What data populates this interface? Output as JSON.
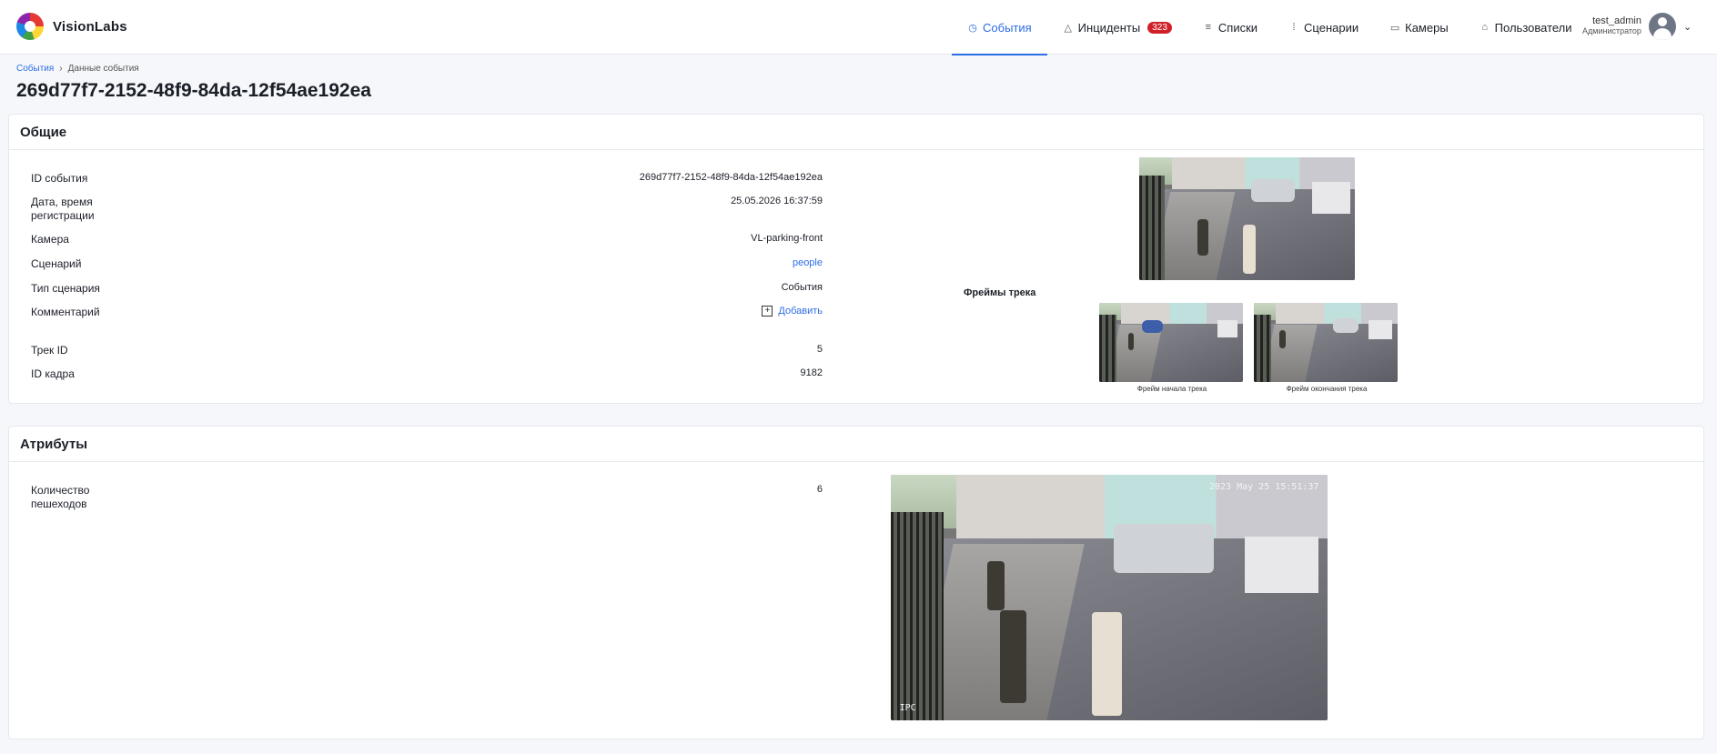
{
  "app": {
    "name": "VisionLabs"
  },
  "nav": {
    "items": [
      {
        "label": "События",
        "icon": "clock-icon"
      },
      {
        "label": "Инциденты",
        "icon": "warning-icon",
        "badge": "323"
      },
      {
        "label": "Списки",
        "icon": "list-icon"
      },
      {
        "label": "Сценарии",
        "icon": "scenario-icon"
      },
      {
        "label": "Камеры",
        "icon": "camera-icon"
      },
      {
        "label": "Пользователи",
        "icon": "users-icon"
      }
    ],
    "active": "События"
  },
  "user": {
    "name": "test_admin",
    "role": "Администратор"
  },
  "breadcrumb": {
    "root": "События",
    "current": "Данные события"
  },
  "page": {
    "title": "269d77f7-2152-48f9-84da-12f54ae192ea"
  },
  "general": {
    "title": "Общие",
    "fields": {
      "event_id": {
        "label": "ID события",
        "value": "269d77f7-2152-48f9-84da-12f54ae192ea"
      },
      "datetime": {
        "label": "Дата, время регистрации",
        "value": "25.05.2026 16:37:59"
      },
      "camera": {
        "label": "Камера",
        "value": "VL-parking-front"
      },
      "scenario": {
        "label": "Сценарий",
        "value": "people"
      },
      "scenario_type": {
        "label": "Тип сценария",
        "value": "События"
      },
      "comment": {
        "label": "Комментарий",
        "action": "Добавить"
      },
      "track_id": {
        "label": "Трек ID",
        "value": "5"
      },
      "frame_id": {
        "label": "ID кадра",
        "value": "9182"
      }
    },
    "frames_title": "Фреймы трека",
    "frame_start_caption": "Фрейм начала трека",
    "frame_end_caption": "Фрейм окончания трека"
  },
  "attributes": {
    "title": "Атрибуты",
    "pedestrians": {
      "label": "Количество пешеходов",
      "value": "6"
    },
    "image_timestamp": "2023 May 25 15:51:37",
    "image_watermark": "IPC"
  },
  "colors": {
    "accent": "#2d6de5",
    "badge": "#d0212a"
  }
}
